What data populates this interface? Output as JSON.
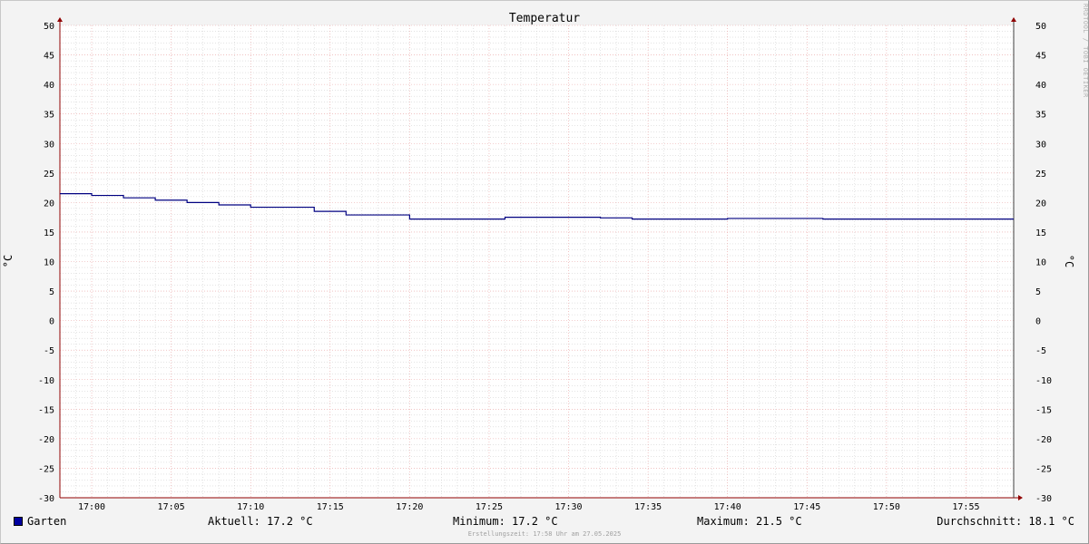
{
  "colors": {
    "background": "#f3f3f3",
    "canvas": "#ffffff",
    "major_grid": "#e8a0a0",
    "minor_grid": "#c8c8c8",
    "series": "#000080",
    "axis": "#900000"
  },
  "watermark": "RRDTOOL / TOBI OETIKER",
  "footer": "Erstellungszeit: 17:58 Uhr am 27.05.2025",
  "legend": {
    "series_name": "Garten",
    "current": "Aktuell: 17.2 °C",
    "minimum": "Minimum: 17.2 °C",
    "maximum": "Maximum: 21.5 °C",
    "average": "Durchschnitt: 18.1 °C"
  },
  "chart_data": {
    "type": "line",
    "title": "Temperatur",
    "ylabel": "°C",
    "ylabel_right": "°C",
    "ylim": [
      -30,
      50
    ],
    "y_ticks": [
      50,
      45,
      40,
      35,
      30,
      25,
      20,
      15,
      10,
      5,
      0,
      -5,
      -10,
      -15,
      -20,
      -25,
      -30
    ],
    "x_unit": "minutes",
    "xlim": [
      "16:58",
      "17:58"
    ],
    "x_ticks": [
      "17:00",
      "17:05",
      "17:10",
      "17:15",
      "17:20",
      "17:25",
      "17:30",
      "17:35",
      "17:40",
      "17:45",
      "17:50",
      "17:55"
    ],
    "grid": true,
    "series": [
      {
        "name": "Garten",
        "step": true,
        "x": [
          "16:58",
          "17:00",
          "17:02",
          "17:04",
          "17:06",
          "17:08",
          "17:10",
          "17:12",
          "17:14",
          "17:16",
          "17:18",
          "17:20",
          "17:22",
          "17:24",
          "17:26",
          "17:28",
          "17:30",
          "17:32",
          "17:34",
          "17:36",
          "17:38",
          "17:40",
          "17:42",
          "17:44",
          "17:46",
          "17:48",
          "17:50",
          "17:52",
          "17:54",
          "17:56",
          "17:58"
        ],
        "values": [
          21.5,
          21.2,
          20.8,
          20.4,
          20.0,
          19.6,
          19.2,
          19.2,
          18.5,
          17.9,
          17.9,
          17.2,
          17.2,
          17.2,
          17.5,
          17.5,
          17.5,
          17.4,
          17.2,
          17.2,
          17.2,
          17.3,
          17.3,
          17.3,
          17.2,
          17.2,
          17.2,
          17.2,
          17.2,
          17.2,
          17.2
        ]
      }
    ]
  }
}
